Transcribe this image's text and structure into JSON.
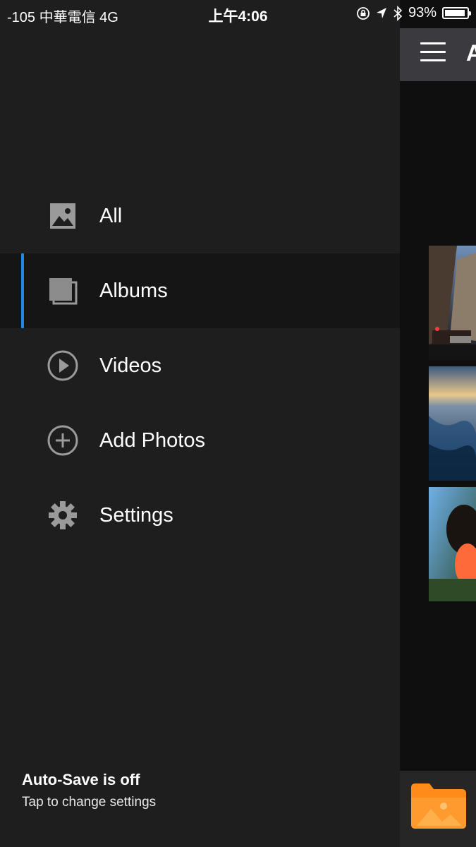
{
  "status_bar": {
    "carrier": "-105 中華電信  4G",
    "time": "上午4:06",
    "battery": "93%",
    "battery_level": 0.93
  },
  "drawer": {
    "menu": [
      {
        "label": "All",
        "icon": "image-icon",
        "active": false
      },
      {
        "label": "Albums",
        "icon": "albums-icon",
        "active": true
      },
      {
        "label": "Videos",
        "icon": "play-circle-icon",
        "active": false
      },
      {
        "label": "Add Photos",
        "icon": "plus-circle-icon",
        "active": false
      },
      {
        "label": "Settings",
        "icon": "gear-icon",
        "active": false
      }
    ],
    "autosave": {
      "title": "Auto-Save is off",
      "subtitle": "Tap to change settings"
    }
  },
  "main": {
    "title_partial": "A",
    "thumbnails": [
      "city-street-photo",
      "ocean-sunset-photo",
      "dog-photo"
    ]
  },
  "colors": {
    "accent": "#1e88e5",
    "folder": "#ff8c1a",
    "drawer_bg": "#1e1e1e"
  }
}
